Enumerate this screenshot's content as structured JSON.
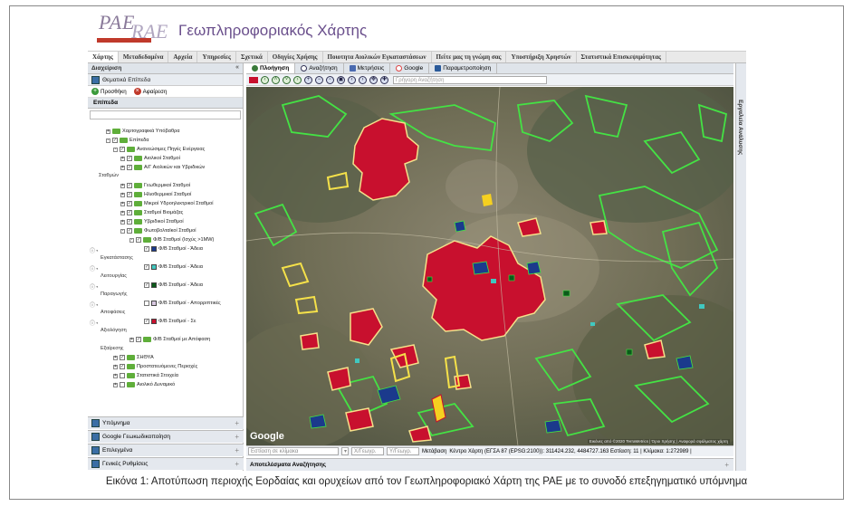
{
  "header": {
    "logo_line1": "PAE",
    "logo_line2": "RAE",
    "title": "Γεωπληροφοριακός Χάρτης"
  },
  "menu": [
    "Χάρτης",
    "Μεταδεδομένα",
    "Αρχεία",
    "Υπηρεσίες",
    "Σχετικά",
    "Οδηγίες Χρήσης",
    "Ποιοτητα Αιολικών Εγκαταστάσεων",
    "Πείτε μας τη γνώμη σας",
    "Υποστήριξη Χρηστών",
    "Στατιστικά Επισκεψιμότητας"
  ],
  "left_panel": {
    "header": "Διαχείριση",
    "thematic": "Θεματικά Επίπεδα",
    "add": "Προσθήκη",
    "remove": "Αφαίρεση",
    "layers_tab": "Επίπεδα",
    "tree": [
      {
        "label": "Χαρτογραφικά Υπόβαθρα"
      },
      {
        "label": "Επίπεδα"
      },
      {
        "label": "Ανανεώσιμες Πηγές Ενέργειας"
      },
      {
        "label": "Αιολικοί Σταθμοί"
      },
      {
        "label": "Α/Γ Αιολικών και Υβριδικών"
      },
      {
        "label": "Σταθμών"
      },
      {
        "label": "Γεωθερμικοί Σταθμοί"
      },
      {
        "label": "Ηλιοθερμικοί Σταθμοί"
      },
      {
        "label": "Μικροί Υδροηλεκτρικοί Σταθμοί"
      },
      {
        "label": "Σταθμοί Βιομάζας"
      },
      {
        "label": "Υβριδικοί Σταθμοί"
      },
      {
        "label": "Φωτοβολταϊκοί Σταθμοί"
      },
      {
        "label": "Φ/Β Σταθμοί (Ισχύς >1MW)"
      },
      {
        "label": "Φ/Β Σταθμοί - Άδεια"
      },
      {
        "label": "Εγκατάστασης"
      },
      {
        "label": "Φ/Β Σταθμοί - Άδεια"
      },
      {
        "label": "Λειτουργίας"
      },
      {
        "label": "Φ/Β Σταθμοί - Άδεια"
      },
      {
        "label": "Παραγωγής"
      },
      {
        "label": "Φ/Β Σταθμοί - Απορριπτικές"
      },
      {
        "label": "Αποφάσεις"
      },
      {
        "label": "Φ/Β Σταθμοί - Σε"
      },
      {
        "label": "Αξιολόγηση"
      },
      {
        "label": "Φ/Β Σταθμοί με Απόφαση"
      },
      {
        "label": "Εξαίρεσης"
      },
      {
        "label": "ΣΗΘΥΑ"
      },
      {
        "label": "Προστατευόμενες Περιοχές"
      },
      {
        "label": "Στατιστικά Στοιχεία"
      },
      {
        "label": "Αιολικό Δυναμικό"
      }
    ],
    "swatch_colors": [
      "#1b3a8c",
      "#40c8c0",
      "#0b5a1a",
      "#d8c8e0",
      "#c8102e"
    ],
    "accordion": [
      "Υπόμνημα",
      "Google Γεωκωδικοποίηση",
      "Επιλεγμένα",
      "Γενικές Ρυθμίσεις"
    ]
  },
  "main": {
    "tabs": [
      "Πλοήγηση",
      "Αναζήτηση",
      "Μετρήσεις",
      "Google",
      "Παραμετροποίηση"
    ],
    "quick_search_placeholder": "Γρήγορη Αναζήτηση",
    "status": {
      "search_placeholder": "Εστίαση σε κλίμακα",
      "x_placeholder": "Χ/Γεωγρ.",
      "y_placeholder": "Υ/Γεωγρ.",
      "focus": "Μετάβαση",
      "center": "Κέντρο Χάρτη (ΕΓΣΑ 87 (EPSG:2100)): 311424.232, 4484727.163 Εστίαση: 11 | Κλίμακα: 1:272989 |"
    },
    "bottom_panel": "Αποτελέσματα Αναζήτησης",
    "google": "Google",
    "attribution": "Εικόνες από ©2020 TerraMetrics | Όροι Χρήσης | Αναφορά σφάλματος χάρτη"
  },
  "right_panel": "Εργαλεία Ανάλυσης",
  "caption": "Εικόνα 1: Αποτύπωση περιοχής Εορδαίας και ορυχείων από τον Γεωπληροφοριακό Χάρτη της ΡΑΕ με το συνοδό επεξηγηματικό υπόμνημα"
}
